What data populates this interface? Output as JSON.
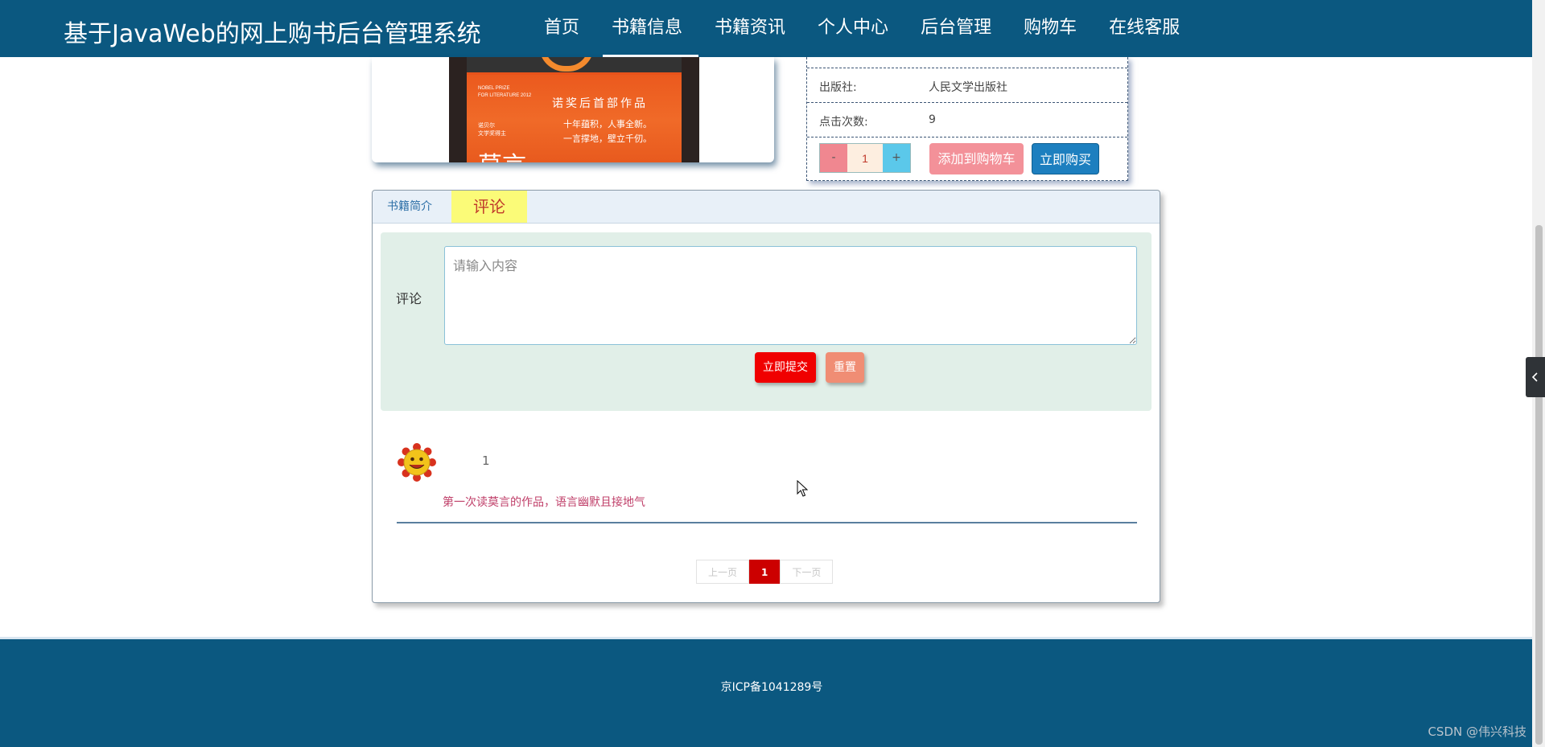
{
  "header": {
    "title": "基于JavaWeb的网上购书后台管理系统",
    "nav": [
      "首页",
      "书籍信息",
      "书籍资讯",
      "个人中心",
      "后台管理",
      "购物车",
      "在线客服"
    ],
    "active_nav": "书籍信息"
  },
  "book": {
    "cover": {
      "line1": "NOBEL PRIZE",
      "line2": "FOR LITERATURE 2012",
      "series": "诺奖后首部作品",
      "tag1": "十年蕴积，人事全新。",
      "tag2": "一言撑地，壁立千仞。",
      "side1": "诺贝尔",
      "side2": "文学奖得主",
      "author": "莫言"
    },
    "info": [
      {
        "label": "出版社:",
        "value": "人民文学出版社"
      },
      {
        "label": "点击次数:",
        "value": "9"
      }
    ],
    "quantity": {
      "minus": "-",
      "value": "1",
      "plus": "+"
    },
    "add_to_cart": "添加到购物车",
    "buy_now": "立即购买"
  },
  "tabs": {
    "intro": "书籍简介",
    "comment": "评论",
    "active": "评论"
  },
  "comment_form": {
    "label": "评论",
    "placeholder": "请输入内容",
    "submit": "立即提交",
    "reset": "重置"
  },
  "comments": [
    {
      "user": "1",
      "text": "第一次读莫言的作品，语言幽默且接地气",
      "avatar": "sunflower-smiley-avatar"
    }
  ],
  "pager": {
    "prev": "上一页",
    "current": "1",
    "next": "下一页"
  },
  "footer": {
    "icp": "京ICP备1041289号",
    "watermark": "CSDN @伟兴科技"
  },
  "colors": {
    "header_bg": "#0b5880",
    "submit": "#f00000",
    "reset": "#f08d74",
    "buy": "#1d7fbf",
    "cart": "#f39199",
    "tab_active_bg": "#fbfb78"
  },
  "icons": {
    "side_toggle": "chevron-left-icon"
  }
}
